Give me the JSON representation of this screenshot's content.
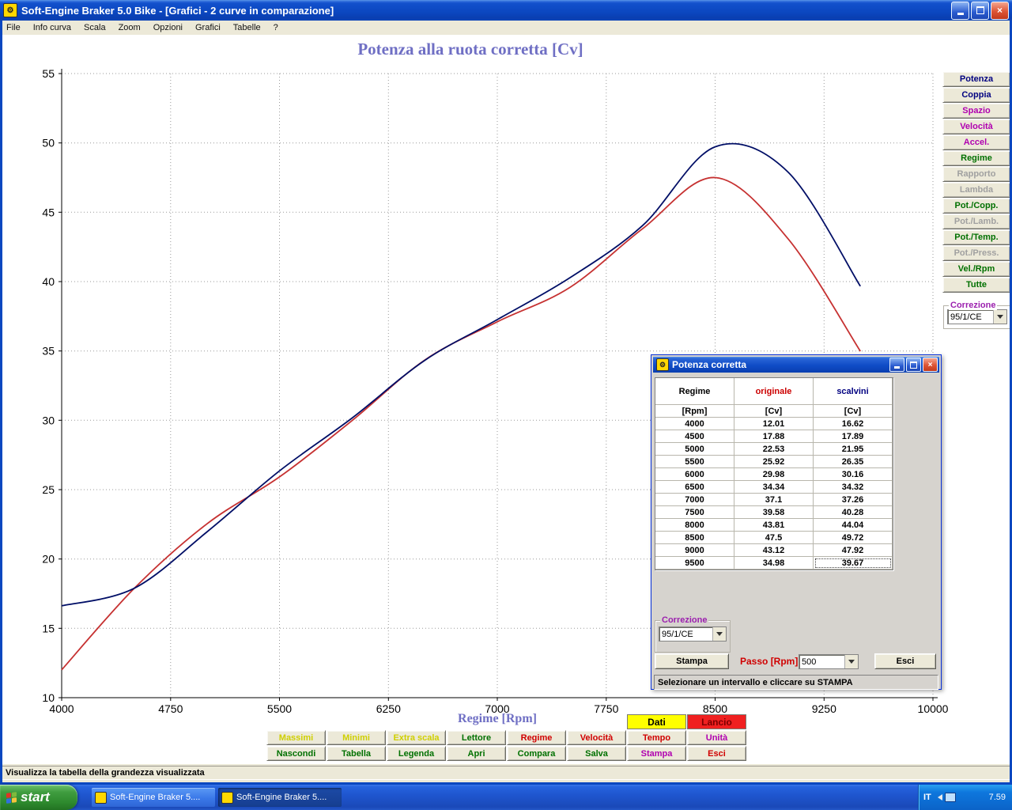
{
  "titlebar": {
    "title": "Soft-Engine Braker 5.0 Bike - [Grafici - 2 curve in comparazione]"
  },
  "menu": {
    "items": [
      "File",
      "Info curva",
      "Scala",
      "Zoom",
      "Opzioni",
      "Grafici",
      "Tabelle",
      "?"
    ]
  },
  "chart_data": {
    "type": "line",
    "title": "Potenza alla ruota corretta [Cv]",
    "xlabel": "Regime [Rpm]",
    "x": [
      4000,
      4500,
      5000,
      5500,
      6000,
      6500,
      7000,
      7500,
      8000,
      8500,
      9000,
      9500
    ],
    "series": [
      {
        "name": "originale",
        "color": "#c63131",
        "values": [
          12.01,
          17.88,
          22.53,
          25.92,
          29.98,
          34.34,
          37.1,
          39.58,
          43.81,
          47.5,
          43.12,
          34.98
        ]
      },
      {
        "name": "scalvini",
        "color": "#000e66",
        "values": [
          16.62,
          17.89,
          21.95,
          26.35,
          30.16,
          34.32,
          37.26,
          40.28,
          44.04,
          49.72,
          47.92,
          39.67
        ]
      }
    ],
    "xticks": [
      4000,
      4750,
      5500,
      6250,
      7000,
      7750,
      8500,
      9250,
      10000
    ],
    "yticks": [
      10,
      15,
      20,
      25,
      30,
      35,
      40,
      45,
      50,
      55
    ],
    "xlim": [
      4000,
      10000
    ],
    "ylim": [
      10,
      55
    ],
    "grid": "dotted"
  },
  "side_panel": {
    "correzione_label": "Correzione",
    "correzione_value": "95/1/CE",
    "buttons": [
      {
        "label": "Potenza",
        "color": "#000080",
        "enabled": true
      },
      {
        "label": "Coppia",
        "color": "#000080",
        "enabled": true
      },
      {
        "label": "Spazio",
        "color": "#b000b0",
        "enabled": true
      },
      {
        "label": "Velocità",
        "color": "#b000b0",
        "enabled": true
      },
      {
        "label": "Accel.",
        "color": "#b000b0",
        "enabled": true
      },
      {
        "label": "Regime",
        "color": "#007000",
        "enabled": true
      },
      {
        "label": "Rapporto",
        "color": "#a0a0a0",
        "enabled": false
      },
      {
        "label": "Lambda",
        "color": "#a0a0a0",
        "enabled": false
      },
      {
        "label": "Pot./Copp.",
        "color": "#007000",
        "enabled": true
      },
      {
        "label": "Pot./Lamb.",
        "color": "#a0a0a0",
        "enabled": false
      },
      {
        "label": "Pot./Temp.",
        "color": "#007000",
        "enabled": true
      },
      {
        "label": "Pot./Press.",
        "color": "#a0a0a0",
        "enabled": false
      },
      {
        "label": "Vel./Rpm",
        "color": "#007000",
        "enabled": true
      },
      {
        "label": "Tutte",
        "color": "#007000",
        "enabled": true
      }
    ]
  },
  "dialog": {
    "title": "Potenza corretta",
    "columns": [
      {
        "label": "Regime",
        "unit": "[Rpm]",
        "color": "#000000"
      },
      {
        "label": "originale",
        "unit": "[Cv]",
        "color": "#cc0000"
      },
      {
        "label": "scalvini",
        "unit": "[Cv]",
        "color": "#000080"
      }
    ],
    "correzione_label": "Correzione",
    "correzione_value": "95/1/CE",
    "stampa_label": "Stampa",
    "passo_label": "Passo [Rpm]",
    "passo_value": "500",
    "esci_label": "Esci",
    "status_text": "Selezionare un intervallo e cliccare su STAMPA"
  },
  "bottom": {
    "dati": {
      "label": "Dati",
      "bg": "#ffff00",
      "color": "#000000"
    },
    "lancio": {
      "label": "Lancio",
      "bg": "#f02020",
      "color": "#7a0000"
    },
    "row1": [
      {
        "label": "Massimi",
        "color": "#cfcf00",
        "enabled": false
      },
      {
        "label": "Minimi",
        "color": "#cfcf00",
        "enabled": false
      },
      {
        "label": "Extra scala",
        "color": "#cfcf00",
        "enabled": false
      },
      {
        "label": "Lettore",
        "color": "#007000",
        "enabled": true
      },
      {
        "label": "Regime",
        "color": "#d00000",
        "enabled": true
      },
      {
        "label": "Velocità",
        "color": "#d00000",
        "enabled": true
      },
      {
        "label": "Tempo",
        "color": "#d00000",
        "enabled": true
      },
      {
        "label": "Unità",
        "color": "#b000b0",
        "enabled": true
      }
    ],
    "row2": [
      {
        "label": "Nascondi",
        "color": "#007000",
        "enabled": true
      },
      {
        "label": "Tabella",
        "color": "#007000",
        "enabled": true
      },
      {
        "label": "Legenda",
        "color": "#007000",
        "enabled": true
      },
      {
        "label": "Apri",
        "color": "#007000",
        "enabled": true
      },
      {
        "label": "Compara",
        "color": "#007000",
        "enabled": true
      },
      {
        "label": "Salva",
        "color": "#007000",
        "enabled": true
      },
      {
        "label": "Stampa",
        "color": "#b000b0",
        "enabled": true
      },
      {
        "label": "Esci",
        "color": "#d00000",
        "enabled": true
      }
    ]
  },
  "statusbar": {
    "text": "Visualizza la tabella della grandezza visualizzata"
  },
  "taskbar": {
    "start_label": "start",
    "tasks": [
      "Soft-Engine Braker 5....",
      "Soft-Engine Braker 5...."
    ],
    "tray": {
      "lang": "IT",
      "time": "7.59"
    }
  }
}
